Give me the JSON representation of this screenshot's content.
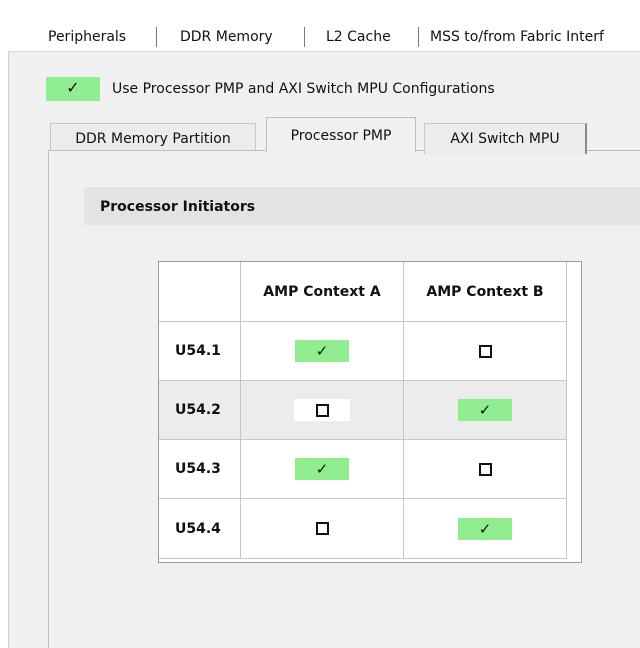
{
  "top_tabs": [
    {
      "label": "Peripherals"
    },
    {
      "label": "DDR Memory"
    },
    {
      "label": "L2 Cache"
    },
    {
      "label": "MSS to/from Fabric Interf"
    }
  ],
  "pmp_option": {
    "label": "Use Processor PMP and AXI Switch MPU Configurations",
    "checked": true,
    "check_glyph": "✓",
    "color": "#90ee90"
  },
  "inner_tabs": [
    {
      "label": "DDR Memory Partition",
      "active": false
    },
    {
      "label": "Processor PMP",
      "active": true
    },
    {
      "label": "AXI Switch MPU",
      "active": false
    }
  ],
  "section": {
    "title": "Processor Initiators"
  },
  "table": {
    "columns": [
      "AMP Context A",
      "AMP Context B"
    ],
    "check_glyph": "✓",
    "rows": [
      {
        "label": "U54.1",
        "context_a": true,
        "context_b": false
      },
      {
        "label": "U54.2",
        "context_a": false,
        "context_b": true
      },
      {
        "label": "U54.3",
        "context_a": true,
        "context_b": false
      },
      {
        "label": "U54.4",
        "context_a": false,
        "context_b": true
      }
    ]
  },
  "colors": {
    "checked_bg": "#90ee90",
    "panel_bg": "#f0f0f0",
    "header_bg": "#e3e3e3"
  }
}
